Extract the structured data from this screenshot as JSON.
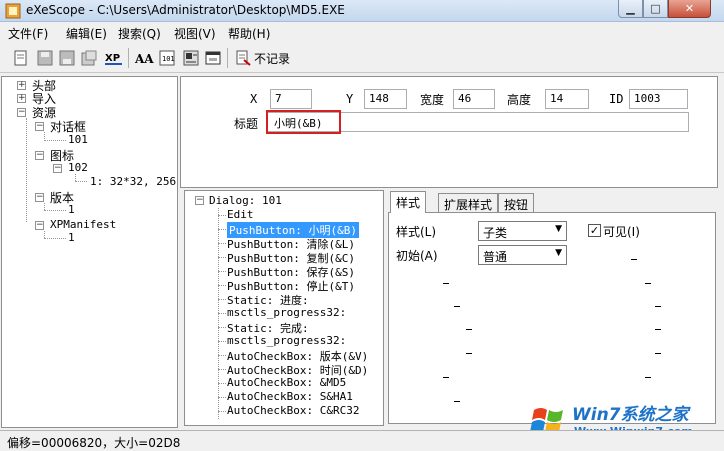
{
  "window": {
    "title": "eXeScope - C:\\Users\\Administrator\\Desktop\\MD5.EXE"
  },
  "menu": [
    "文件(F)",
    "编辑(E)",
    "搜索(Q)",
    "视图(V)",
    "帮助(H)"
  ],
  "toolbar": {
    "no_record_label": "不记录"
  },
  "left_tree": {
    "header": "头部",
    "import": "导入",
    "resource": "资源",
    "dialog": "对话框",
    "dialog_101": "101",
    "icon": "图标",
    "icon_102": "102",
    "icon_102_1": "1: 32*32, 256",
    "version": "版本",
    "version_1": "1",
    "xpmanifest": "XPManifest",
    "xpmanifest_1": "1"
  },
  "props": {
    "x_label": "X",
    "x_value": "7",
    "y_label": "Y",
    "y_value": "148",
    "width_label": "宽度",
    "width_value": "46",
    "height_label": "高度",
    "height_value": "14",
    "id_label": "ID",
    "id_value": "1003",
    "caption_label": "标题",
    "caption_value": "小明(&B)"
  },
  "dialog_tree": {
    "root": "Dialog: 101",
    "items": [
      "Edit",
      "PushButton: 小明(&B)",
      "PushButton: 清除(&L)",
      "PushButton: 复制(&C)",
      "PushButton: 保存(&S)",
      "PushButton: 停止(&T)",
      "Static: 进度:",
      "msctls_progress32:",
      "Static: 完成:",
      "msctls_progress32:",
      "AutoCheckBox: 版本(&V)",
      "AutoCheckBox: 时间(&D)",
      "AutoCheckBox: &MD5",
      "AutoCheckBox: S&HA1",
      "AutoCheckBox: C&RC32"
    ],
    "selected_index": 1
  },
  "tabs": {
    "style": "样式",
    "ext_style": "扩展样式",
    "button": "按钮"
  },
  "style_tab": {
    "style_label": "样式(L)",
    "style_value": "子类",
    "visible_label": "可见(I)",
    "initial_label": "初始(A)",
    "initial_value": "普通"
  },
  "watermark": {
    "brand": "Win7系统之家",
    "url": "Www.Winwin7.com"
  },
  "status": "偏移=00006820，大小=02D8"
}
